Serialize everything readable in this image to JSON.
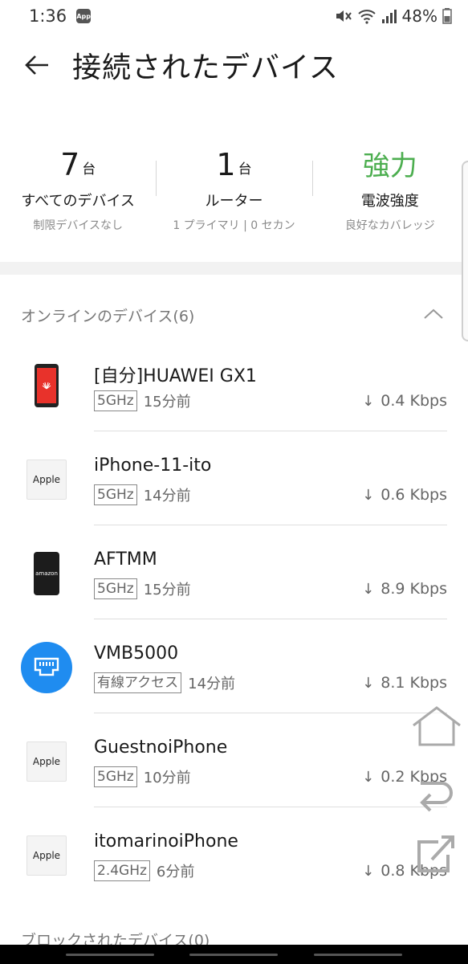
{
  "status_bar": {
    "time": "1:36",
    "app_badge": "App",
    "battery": "48%"
  },
  "header": {
    "title": "接続されたデバイス"
  },
  "summary": [
    {
      "value": "7",
      "unit": "台",
      "label": "すべてのデバイス",
      "sub": "制限デバイスなし"
    },
    {
      "value": "1",
      "unit": "台",
      "label": "ルーター",
      "sub": "1 プライマリ | 0 セカン"
    },
    {
      "value": "強力",
      "label": "電波強度",
      "sub": "良好なカバレッジ",
      "color": "#4cae4f"
    }
  ],
  "online_section": {
    "title": "オンラインのデバイス(6)"
  },
  "devices": [
    {
      "name": "[自分]HUAWEI GX1",
      "band": "5GHz",
      "time": "15分前",
      "speed": "0.4 Kbps",
      "icon": "huawei-phone-icon"
    },
    {
      "name": "iPhone-11-ito",
      "band": "5GHz",
      "time": "14分前",
      "speed": "0.6 Kbps",
      "icon": "apple-icon",
      "icon_text": "Apple"
    },
    {
      "name": "AFTMM",
      "band": "5GHz",
      "time": "15分前",
      "speed": "8.9 Kbps",
      "icon": "amazon-tablet-icon",
      "icon_text": "amazon"
    },
    {
      "name": "VMB5000",
      "band": "有線アクセス",
      "time": "14分前",
      "speed": "8.1 Kbps",
      "icon": "ethernet-icon"
    },
    {
      "name": "GuestnoiPhone",
      "band": "5GHz",
      "time": "10分前",
      "speed": "0.2 Kbps",
      "icon": "apple-icon",
      "icon_text": "Apple"
    },
    {
      "name": "itomarinoiPhone",
      "band": "2.4GHz",
      "time": "6分前",
      "speed": "0.8 Kbps",
      "icon": "apple-icon",
      "icon_text": "Apple"
    }
  ],
  "blocked_section": {
    "title": "ブロックされたデバイス(0)"
  },
  "colors": {
    "accent_green": "#4cae4f",
    "ethernet_blue": "#1f8cf0"
  }
}
